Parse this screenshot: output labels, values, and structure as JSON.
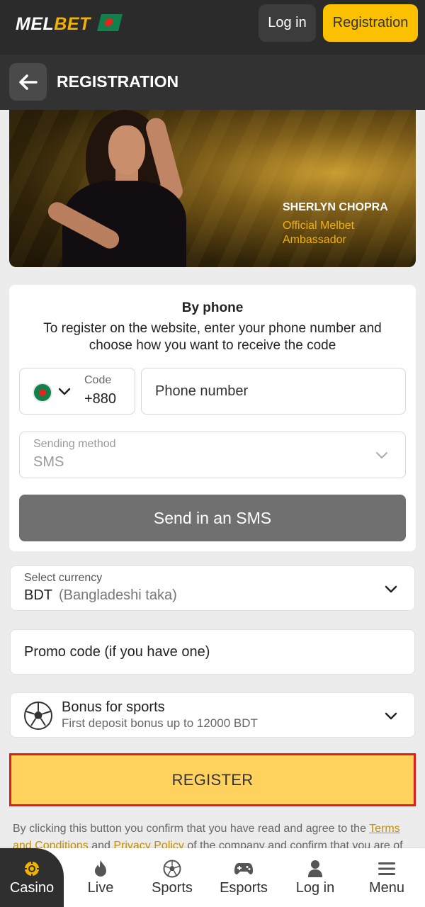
{
  "header": {
    "logo_mel": "MEL",
    "logo_bet": "BET",
    "login_label": "Log in",
    "registration_label": "Registration"
  },
  "subheader": {
    "title": "REGISTRATION"
  },
  "banner": {
    "ambassador_name": "SHERLYN CHOPRA",
    "ambassador_role_line1": "Official Melbet",
    "ambassador_role_line2": "Ambassador"
  },
  "phone_form": {
    "title": "By phone",
    "description": "To register on the website, enter your phone number and choose how you want to receive the code",
    "code_label": "Code",
    "code_value": "+880",
    "phone_placeholder": "Phone number",
    "method_label": "Sending method",
    "method_value": "SMS",
    "send_button": "Send in an SMS"
  },
  "currency": {
    "label": "Select currency",
    "code": "BDT",
    "name": "(Bangladeshi taka)"
  },
  "promo": {
    "placeholder": "Promo code (if you have one)"
  },
  "bonus": {
    "title": "Bonus for sports",
    "subtitle": "First deposit bonus up to 12000 BDT"
  },
  "register_button": "REGISTER",
  "terms": {
    "prefix": "By clicking this button you confirm that you have read and agree to the ",
    "terms_link": "Terms and Conditions",
    "and": " and ",
    "privacy_link": "Privacy Policy",
    "suffix": " of the company and confirm that you are of"
  },
  "bottom_nav": {
    "items": [
      {
        "label": "Casino",
        "icon": "casino-chip-icon"
      },
      {
        "label": "Live",
        "icon": "fire-icon"
      },
      {
        "label": "Sports",
        "icon": "soccer-ball-icon"
      },
      {
        "label": "Esports",
        "icon": "gamepad-icon"
      },
      {
        "label": "Log in",
        "icon": "user-icon"
      },
      {
        "label": "Menu",
        "icon": "hamburger-menu-icon"
      }
    ]
  },
  "colors": {
    "accent": "#fbc000",
    "register_button": "#ffd25e",
    "highlight_border": "#e41b1b",
    "header_bg": "#2b2b2b"
  }
}
